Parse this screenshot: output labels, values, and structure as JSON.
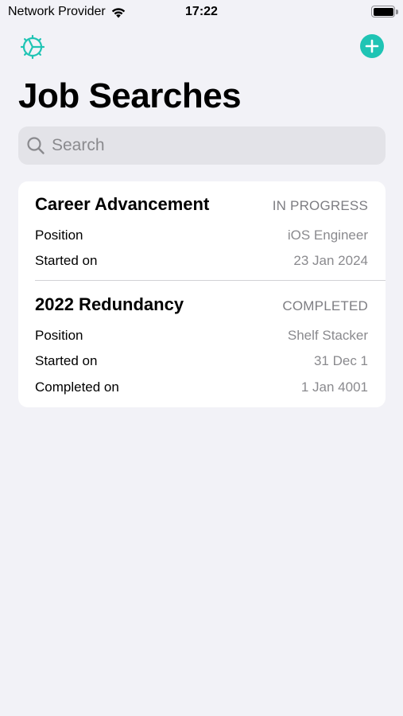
{
  "status_bar": {
    "carrier": "Network Provider",
    "time": "17:22",
    "icons": [
      "wifi-icon",
      "battery-icon"
    ]
  },
  "nav": {
    "left_icon": "timer-gear-icon",
    "right_icon": "plus-circle-icon",
    "accent_color": "#1fc4b4"
  },
  "title": "Job Searches",
  "search": {
    "placeholder": "Search",
    "value": ""
  },
  "job_searches": [
    {
      "title": "Career Advancement",
      "status": "IN PROGRESS",
      "rows": [
        {
          "label": "Position",
          "value": "iOS Engineer"
        },
        {
          "label": "Started on",
          "value": "23 Jan 2024"
        }
      ]
    },
    {
      "title": "2022 Redundancy",
      "status": "COMPLETED",
      "rows": [
        {
          "label": "Position",
          "value": "Shelf Stacker"
        },
        {
          "label": "Started on",
          "value": "31 Dec 1"
        },
        {
          "label": "Completed on",
          "value": "1 Jan 4001"
        }
      ]
    }
  ]
}
